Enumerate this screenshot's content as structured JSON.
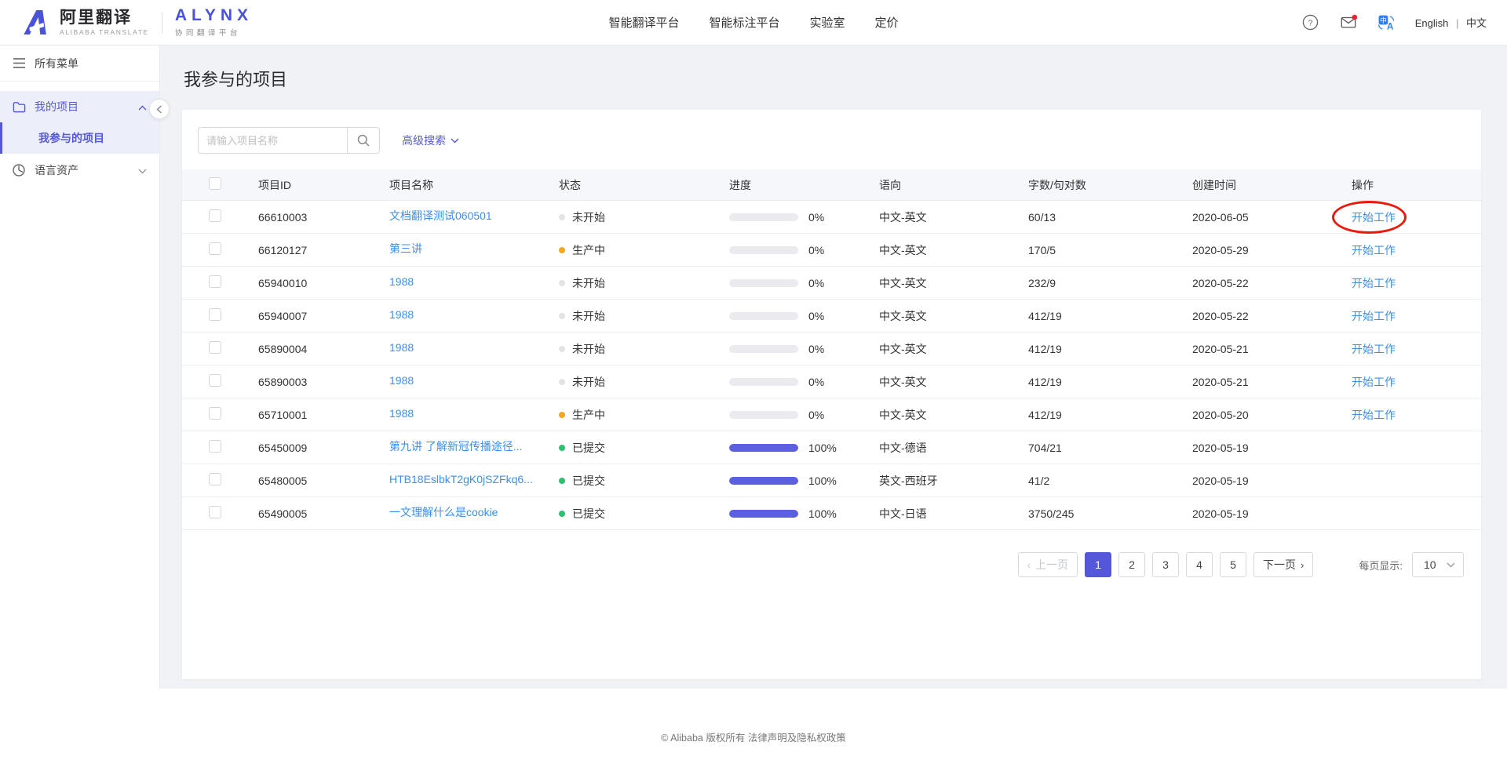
{
  "header": {
    "logo": {
      "brand_cn": "阿里翻译",
      "brand_en": "ALIBABA TRANSLATE",
      "product": "ALYNX",
      "product_sub": "协同翻译平台"
    },
    "nav": [
      "智能翻译平台",
      "智能标注平台",
      "实验室",
      "定价"
    ],
    "lang": {
      "english": "English",
      "divider": "|",
      "chinese": "中文"
    },
    "icons": [
      "help-icon",
      "mail-icon-with-red-badge",
      "translate-icon"
    ]
  },
  "sidebar": {
    "all_menu": "所有菜单",
    "group": "我的项目",
    "active_item": "我参与的项目",
    "plain_item": "语言资产"
  },
  "page": {
    "title": "我参与的项目"
  },
  "search": {
    "placeholder": "请输入项目名称",
    "advanced_label": "高级搜索"
  },
  "table": {
    "columns": [
      "项目ID",
      "项目名称",
      "状态",
      "进度",
      "语向",
      "字数/句对数",
      "创建时间",
      "操作"
    ],
    "rows": [
      {
        "id": "66610003",
        "name": "文档翻译测试060501",
        "status": "未开始",
        "status_type": "not_started",
        "progress": 0,
        "progress_label": "0%",
        "lang_pair": "中文-英文",
        "words": "60/13",
        "created": "2020-06-05",
        "action": "开始工作",
        "annotated": true
      },
      {
        "id": "66120127",
        "name": "第三讲",
        "status": "生产中",
        "status_type": "in_production",
        "progress": 0,
        "progress_label": "0%",
        "lang_pair": "中文-英文",
        "words": "170/5",
        "created": "2020-05-29",
        "action": "开始工作",
        "annotated": false
      },
      {
        "id": "65940010",
        "name": "1988",
        "status": "未开始",
        "status_type": "not_started",
        "progress": 0,
        "progress_label": "0%",
        "lang_pair": "中文-英文",
        "words": "232/9",
        "created": "2020-05-22",
        "action": "开始工作",
        "annotated": false
      },
      {
        "id": "65940007",
        "name": "1988",
        "status": "未开始",
        "status_type": "not_started",
        "progress": 0,
        "progress_label": "0%",
        "lang_pair": "中文-英文",
        "words": "412/19",
        "created": "2020-05-22",
        "action": "开始工作",
        "annotated": false
      },
      {
        "id": "65890004",
        "name": "1988",
        "status": "未开始",
        "status_type": "not_started",
        "progress": 0,
        "progress_label": "0%",
        "lang_pair": "中文-英文",
        "words": "412/19",
        "created": "2020-05-21",
        "action": "开始工作",
        "annotated": false
      },
      {
        "id": "65890003",
        "name": "1988",
        "status": "未开始",
        "status_type": "not_started",
        "progress": 0,
        "progress_label": "0%",
        "lang_pair": "中文-英文",
        "words": "412/19",
        "created": "2020-05-21",
        "action": "开始工作",
        "annotated": false
      },
      {
        "id": "65710001",
        "name": "1988",
        "status": "生产中",
        "status_type": "in_production",
        "progress": 0,
        "progress_label": "0%",
        "lang_pair": "中文-英文",
        "words": "412/19",
        "created": "2020-05-20",
        "action": "开始工作",
        "annotated": false
      },
      {
        "id": "65450009",
        "name": "第九讲 了解新冠传播途径...",
        "status": "已提交",
        "status_type": "submitted",
        "progress": 100,
        "progress_label": "100%",
        "lang_pair": "中文-德语",
        "words": "704/21",
        "created": "2020-05-19",
        "action": "",
        "annotated": false
      },
      {
        "id": "65480005",
        "name": "HTB18EslbkT2gK0jSZFkq6...",
        "status": "已提交",
        "status_type": "submitted",
        "progress": 100,
        "progress_label": "100%",
        "lang_pair": "英文-西班牙",
        "words": "41/2",
        "created": "2020-05-19",
        "action": "",
        "annotated": false
      },
      {
        "id": "65490005",
        "name": "一文理解什么是cookie",
        "status": "已提交",
        "status_type": "submitted",
        "progress": 100,
        "progress_label": "100%",
        "lang_pair": "中文-日语",
        "words": "3750/245",
        "created": "2020-05-19",
        "action": "",
        "annotated": false
      }
    ]
  },
  "pagination": {
    "prev": "上一页",
    "pages": [
      "1",
      "2",
      "3",
      "4",
      "5"
    ],
    "active_page": "1",
    "next": "下一页",
    "per_page_label": "每页显示:",
    "per_page": "10"
  },
  "footer": {
    "copyright": "© Alibaba 版权所有 法律声明及隐私权政策"
  },
  "colors": {
    "accent_purple": "#5457d9",
    "link_blue": "#3a8ff0",
    "progress_fill": "#5b5fe0",
    "status_grey": "#e3e3e6",
    "status_orange": "#f5a623",
    "status_green": "#2fbf71",
    "annotation_red": "#e81a0c"
  }
}
